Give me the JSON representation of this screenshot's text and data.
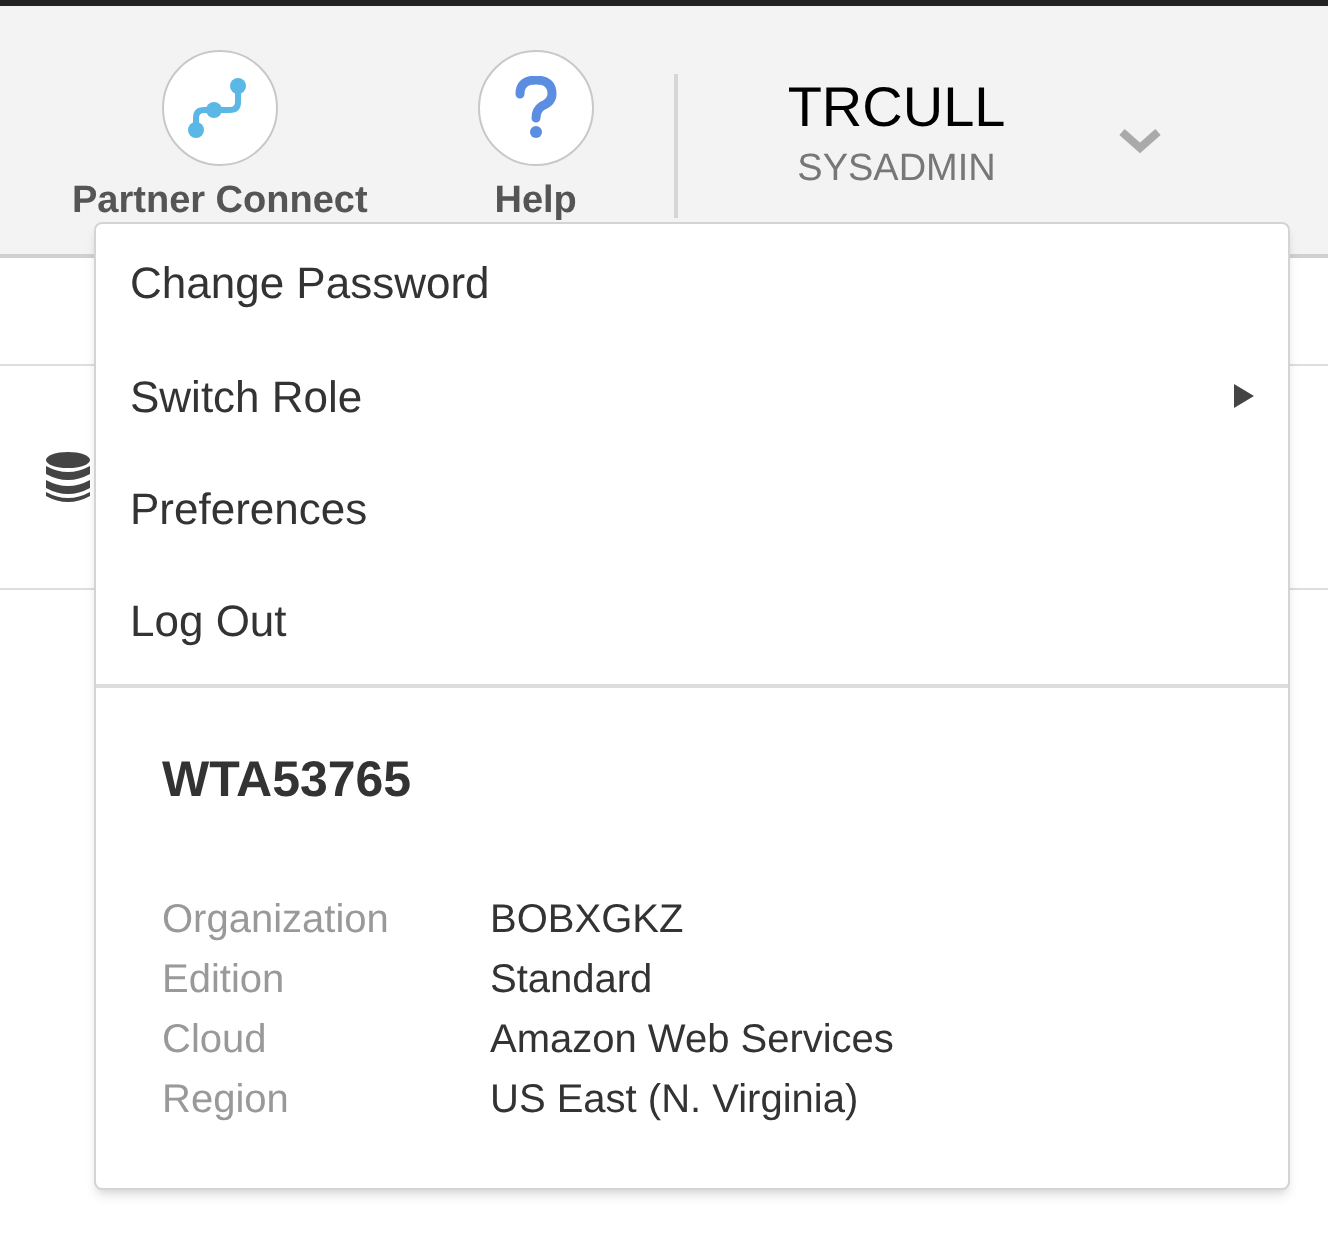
{
  "toolbar": {
    "items": [
      {
        "kind": "connect",
        "label": "Partner Connect"
      },
      {
        "kind": "help",
        "label": "Help"
      }
    ]
  },
  "user": {
    "name": "TRCULL",
    "role": "SYSADMIN"
  },
  "menu": {
    "items": [
      {
        "label": "Change Password",
        "has_submenu": false
      },
      {
        "label": "Switch Role",
        "has_submenu": true
      },
      {
        "label": "Preferences",
        "has_submenu": false
      },
      {
        "label": "Log Out",
        "has_submenu": false
      }
    ],
    "account": {
      "id": "WTA53765",
      "details": [
        {
          "label": "Organization",
          "value": "BOBXGKZ"
        },
        {
          "label": "Edition",
          "value": "Standard"
        },
        {
          "label": "Cloud",
          "value": "Amazon Web Services"
        },
        {
          "label": "Region",
          "value": "US East (N. Virginia)"
        }
      ]
    }
  }
}
